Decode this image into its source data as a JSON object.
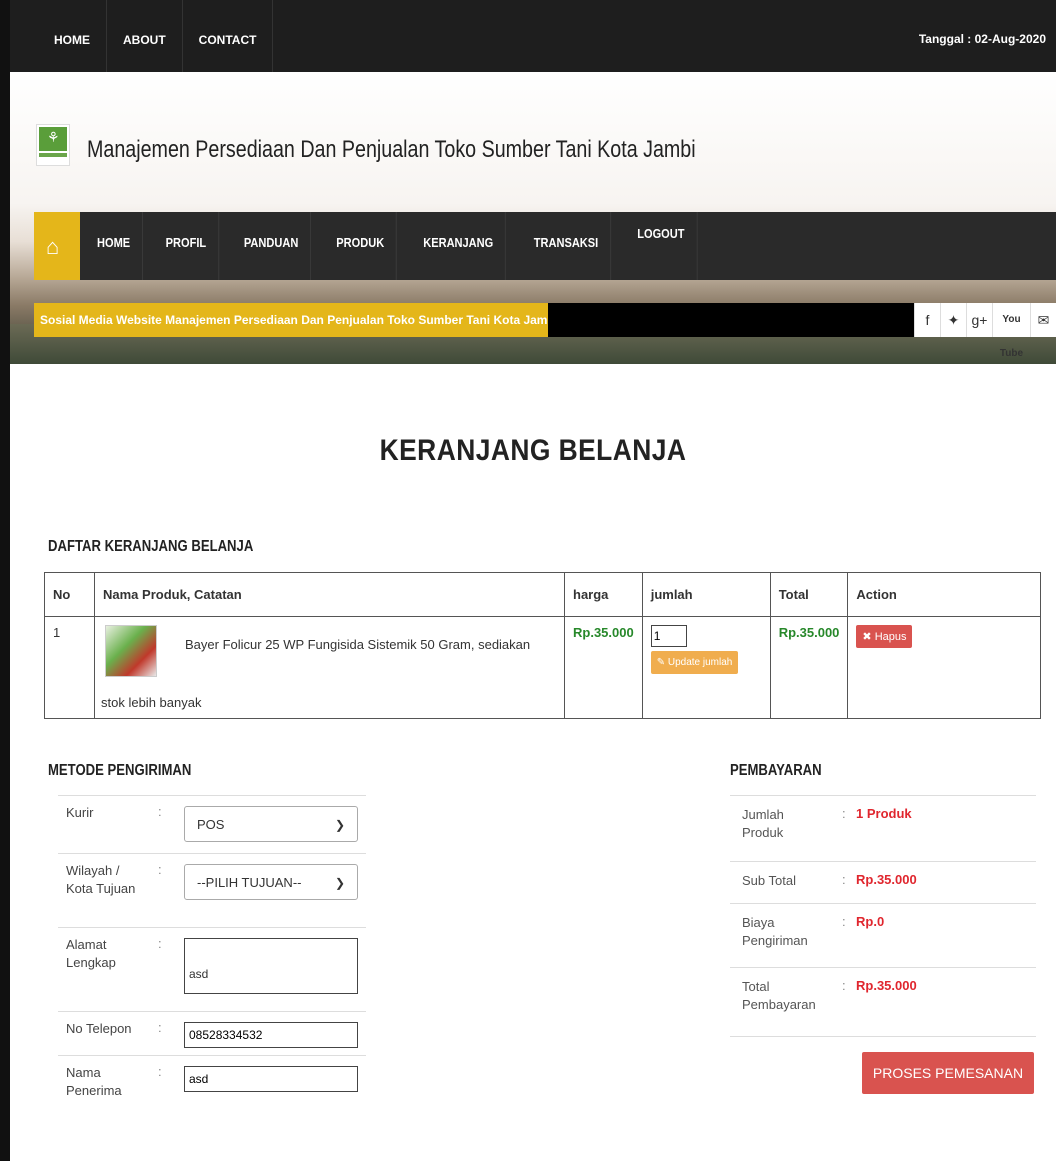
{
  "topbar": {
    "menu": [
      "HOME",
      "ABOUT",
      "CONTACT"
    ],
    "date": "Tanggal : 02-Aug-2020"
  },
  "header": {
    "site_title": "Manajemen Persediaan Dan Penjualan Toko Sumber Tani Kota Jambi"
  },
  "nav": {
    "items": [
      "HOME",
      "PROFIL",
      "PANDUAN",
      "PRODUK",
      "KERANJANG",
      "TRANSAKSI",
      "LOGOUT"
    ]
  },
  "social": {
    "text": "Sosial Media Website Manajemen Persediaan Dan Penjualan Toko Sumber Tani Kota Jambi",
    "icons": [
      "facebook-icon",
      "twitter-icon",
      "google-plus-icon",
      "youtube-icon",
      "email-icon"
    ],
    "youtube_label": "You Tube"
  },
  "page": {
    "heading": "KERANJANG BELANJA",
    "cart_heading": "DAFTAR KERANJANG BELANJA"
  },
  "cart": {
    "columns": [
      "No",
      "Nama Produk, Catatan",
      "harga",
      "jumlah",
      "Total",
      "Action"
    ],
    "rows": [
      {
        "no": "1",
        "name": "Bayer Folicur 25 WP Fungisida Sistemik 50 Gram, sediakan",
        "note": "stok lebih banyak",
        "price": "Rp.35.000",
        "qty": "1",
        "update_label": "Update jumlah",
        "total": "Rp.35.000",
        "delete_label": "Hapus"
      }
    ]
  },
  "shipping": {
    "heading": "METODE PENGIRIMAN",
    "courier_label": "Kurir",
    "courier_value": "POS",
    "region_label": "Wilayah / Kota Tujuan",
    "region_value": "--PILIH TUJUAN--",
    "address_label": "Alamat Lengkap",
    "address_value": "asd",
    "phone_label": "No Telepon",
    "phone_value": "08528334532",
    "recipient_label": "Nama Penerima",
    "recipient_value": "asd"
  },
  "payment": {
    "heading": "PEMBAYARAN",
    "qty_label": "Jumlah Produk",
    "qty_value": "1 Produk",
    "subtotal_label": "Sub Total",
    "subtotal_value": "Rp.35.000",
    "shipping_label": "Biaya Pengiriman",
    "shipping_value": "Rp.0",
    "total_label": "Total Pembayaran",
    "total_value": "Rp.35.000",
    "submit_label": "PROSES PEMESANAN"
  },
  "colors": {
    "accent": "#e4b61a",
    "dark": "#1e1e1e",
    "price_green": "#27882a",
    "danger": "#d9534f",
    "warning": "#f0ad4e",
    "value_red": "#e0262e"
  }
}
